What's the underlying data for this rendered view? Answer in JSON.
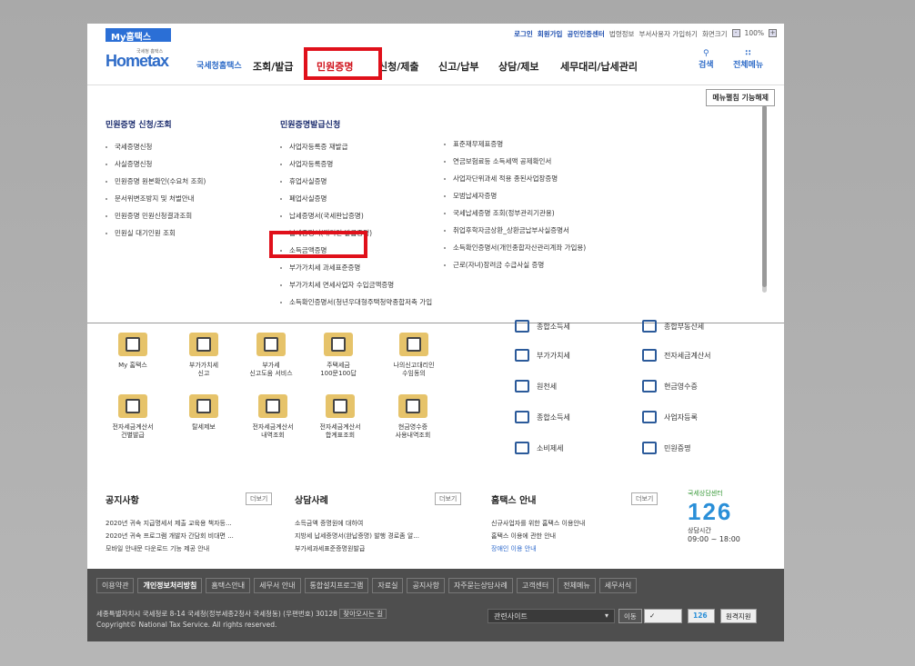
{
  "util": {
    "my_tab": "My홈택스",
    "links": [
      "로그인",
      "회원가입",
      "공인인증센터",
      "법령정보",
      "부서사용자 가입하기",
      "화면크기"
    ],
    "zoom": "100%"
  },
  "logo": {
    "main": "Hometax",
    "sub": "국세청홈택스",
    "tiny": "국세청 홈택스"
  },
  "gnb": {
    "menus": [
      "조회/발급",
      "민원증명",
      "신청/제출",
      "신고/납부",
      "상담/제보",
      "세무대리/납세관리"
    ],
    "active_index": 1,
    "search": "검색",
    "all_menu": "전체메뉴"
  },
  "drop": {
    "menu_fold_off": "메뉴펼침 기능해제",
    "col1_title": "민원증명 신청/조회",
    "col1": [
      "국세증명신청",
      "사실증명신청",
      "민원증명 원본확인(수요처 조회)",
      "문서위변조방지 및 처벌안내",
      "민원증명 민원신청결과조회",
      "민원실 대기인원 조회"
    ],
    "col2_title": "민원증명발급신청",
    "col2": [
      "사업자등록증 재발급",
      "사업자등록증명",
      "휴업사실증명",
      "폐업사실증명",
      "납세증명서(국세완납증명)",
      "납세증명서(대리인 발급증명)",
      "소득금액증명",
      "부가가치세 과세표준증명",
      "부가가치세 면세사업자 수입금액증명",
      "소득확인증명서(청년우대형주택청약종합저축 가입 및 과세특례 신청용)"
    ],
    "col3": [
      "표준재무제표증명",
      "연금보험료등 소득세액 공제확인서",
      "사업자단위과세 적용 종된사업장증명",
      "모범납세자증명",
      "국세납세증명 조회(정부관리기관용)",
      "취업후학자금상환_상환금납부사실증명서",
      "소득확인증명서(개인종합자산관리계좌 가입용)",
      "근로(자녀)장려금 수급사실 증명"
    ]
  },
  "tiles": {
    "left": [
      [
        "My 홈택스",
        ""
      ],
      [
        "부가가치세",
        "신고"
      ],
      [
        "부가세",
        "신고도움 서비스"
      ],
      [
        "주택세금",
        "100문100답"
      ],
      [
        "나의신고대리인",
        "수임동의"
      ],
      [
        "전자세금계산서",
        "건별발급"
      ],
      [
        "탈세제보",
        ""
      ],
      [
        "전자세금계산서",
        "내역조회"
      ],
      [
        "전자세금계산서",
        "합계표조회"
      ],
      [
        "현금영수증",
        "사용내역조회"
      ]
    ],
    "right": [
      "종합소득세",
      "종합부동산세",
      "부가가치세",
      "전자세금계산서",
      "원천세",
      "현금영수증",
      "종합소득세",
      "사업자등록",
      "소비제세",
      "민원증명"
    ]
  },
  "news": {
    "notice_title": "공지사항",
    "notice": [
      "2020년 귀속 지급명세서 제출 교육용 책자등...",
      "2020년 귀속 프로그램 개발자 간담회 비대면 ...",
      "모바일 안내문 다운로드 기능 제공 안내"
    ],
    "cases_title": "상담사례",
    "cases": [
      "소득금액 증명원에 대하여",
      "지방세 납세증명서(완납증명) 발행 경로좀 알...",
      "부가세과세표준증명원발급"
    ],
    "info_title": "홈택스 안내",
    "info": [
      "신규사업자를 위한 홈택스 이용안내",
      "홈택스 이용에 관한 안내",
      "장애인 이용 안내"
    ],
    "more": "더보기",
    "center_title": "국세상담센터",
    "center_num": "126",
    "center_hours_label": "상담시간",
    "center_hours": "09:00 ~ 18:00"
  },
  "footer": {
    "nav": [
      "이용약관",
      "개인정보처리방침",
      "홈택스안내",
      "세무서 안내",
      "통합설치프로그램",
      "자료실",
      "공지사항",
      "자주묻는상담사례",
      "고객센터",
      "전체메뉴",
      "세무서식"
    ],
    "addr": "세종특별자치시 국세청로 8-14 국세청(정부세종2청사 국세청동) (우편번호) 30128",
    "find": "찾아오시는 길",
    "copy": "Copyright© National Tax Service. All rights reserved.",
    "related": "관련사이트",
    "go": "이동",
    "remote": "원격지원"
  }
}
